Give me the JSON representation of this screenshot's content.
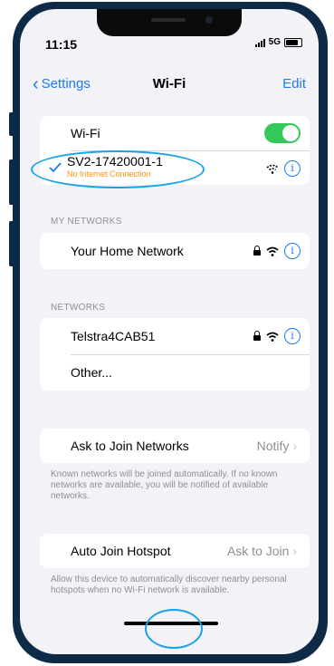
{
  "status": {
    "time": "11:15",
    "network": "5G"
  },
  "nav": {
    "back_label": "Settings",
    "title": "Wi-Fi",
    "edit_label": "Edit"
  },
  "wifi": {
    "toggle_label": "Wi-Fi",
    "toggle_on": true,
    "connected_name": "SV2-17420001-1",
    "connected_status": "No Internet Connection"
  },
  "my_networks": {
    "title": "MY NETWORKS",
    "items": [
      {
        "name": "Your Home Network"
      }
    ]
  },
  "networks": {
    "title": "NETWORKS",
    "items": [
      {
        "name": "Telstra4CAB51"
      }
    ],
    "other_label": "Other..."
  },
  "ask_to_join": {
    "label": "Ask to Join Networks",
    "value": "Notify",
    "note": "Known networks will be joined automatically. If no known networks are available, you will be notified of available networks."
  },
  "auto_join": {
    "label": "Auto Join Hotspot",
    "value": "Ask to Join",
    "note": "Allow this device to automatically discover nearby personal hotspots when no Wi-Fi network is available."
  },
  "colors": {
    "accent": "#1a7bf2",
    "toggle": "#34c759",
    "warning": "#ff9500",
    "annotation": "#18a3e6",
    "frame": "#0f2a47"
  }
}
